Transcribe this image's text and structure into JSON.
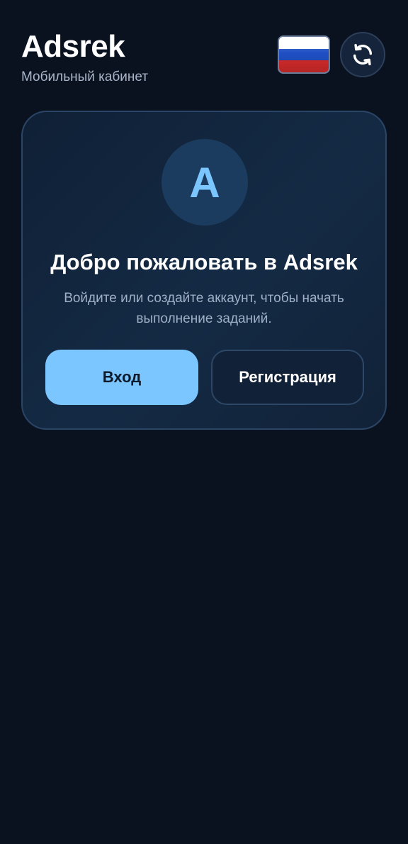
{
  "header": {
    "title": "Adsrek",
    "subtitle": "Мобильный кабинет",
    "language_flag_icon": "russia-flag-icon",
    "refresh_icon": "refresh-icon"
  },
  "card": {
    "avatar_letter": "A",
    "title": "Добро пожаловать в Adsrek",
    "description": "Войдите или создайте аккаунт, чтобы начать выполнение заданий.",
    "login_label": "Вход",
    "register_label": "Регистрация"
  },
  "colors": {
    "background": "#0a1220",
    "accent": "#7cc6ff",
    "card": "#132840"
  }
}
